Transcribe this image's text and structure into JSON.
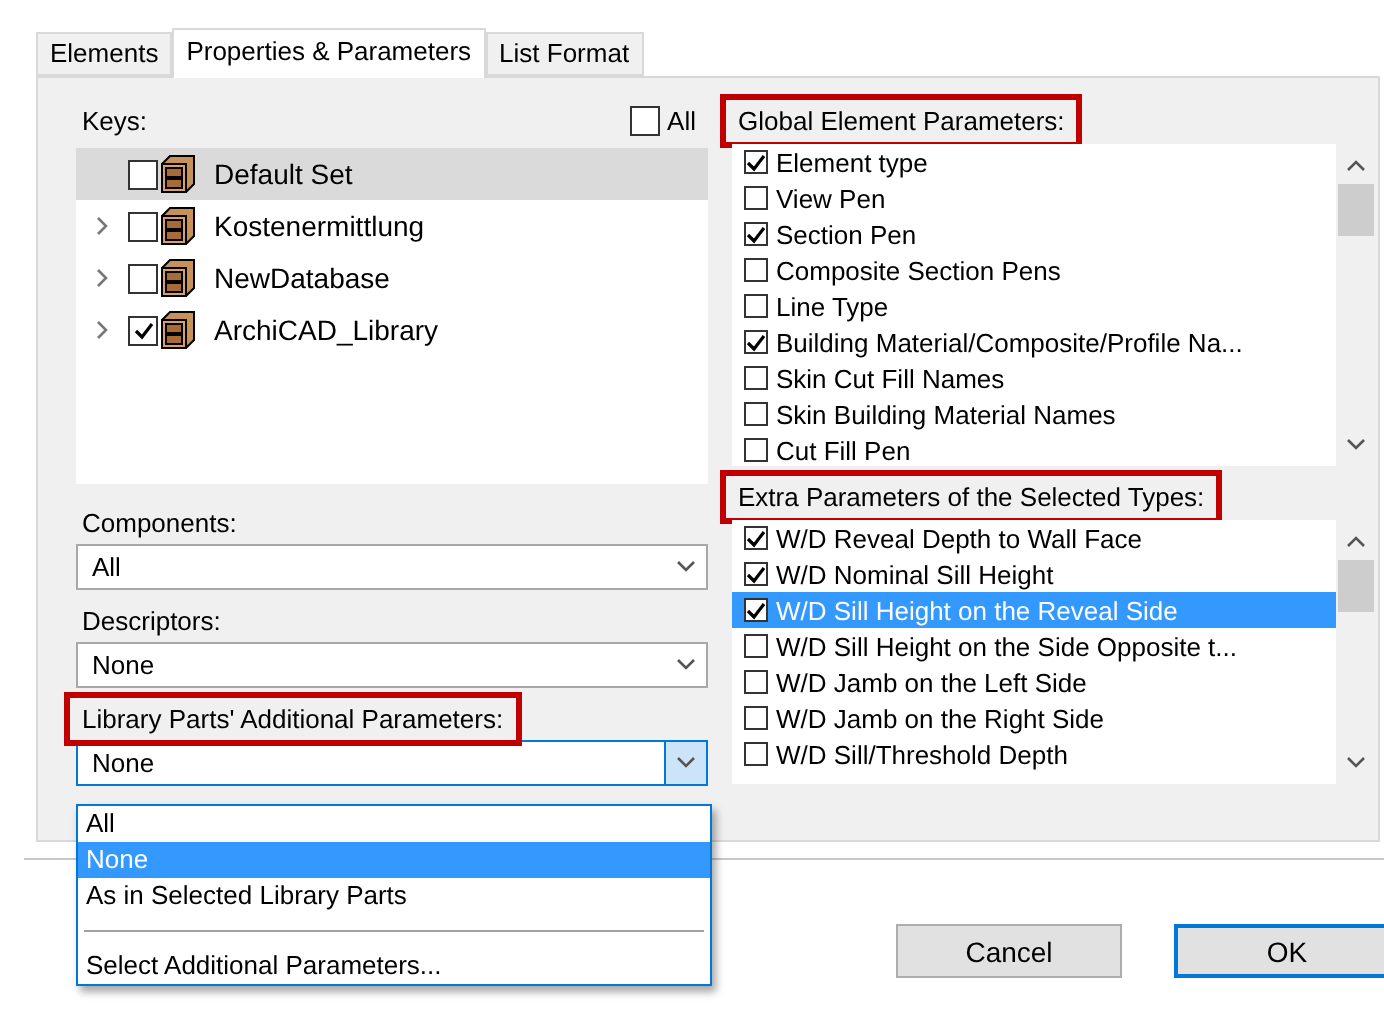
{
  "tabs": [
    {
      "label": "Elements",
      "selected": false
    },
    {
      "label": "Properties & Parameters",
      "selected": true
    },
    {
      "label": "List Format",
      "selected": false
    }
  ],
  "keys": {
    "label": "Keys:",
    "highlighted": false,
    "all_label": "All",
    "all_checked": false,
    "items": [
      {
        "label": "Default Set",
        "checked": false,
        "expandable": false,
        "selected": true
      },
      {
        "label": "Kostenermittlung",
        "checked": false,
        "expandable": true,
        "selected": false
      },
      {
        "label": "NewDatabase",
        "checked": false,
        "expandable": true,
        "selected": false
      },
      {
        "label": "ArchiCAD_Library",
        "checked": true,
        "expandable": true,
        "selected": false
      }
    ]
  },
  "selects": [
    {
      "label": "Components:",
      "highlighted": false,
      "value": "All",
      "expanded": false
    },
    {
      "label": "Descriptors:",
      "highlighted": false,
      "value": "None",
      "expanded": false
    },
    {
      "label": "Library Parts' Additional Parameters:",
      "highlighted": true,
      "value": "None",
      "expanded": true,
      "options": [
        {
          "kind": "option",
          "label": "All",
          "selected": false
        },
        {
          "kind": "option",
          "label": "None",
          "selected": true
        },
        {
          "kind": "option",
          "label": "As in Selected Library Parts",
          "selected": false
        },
        {
          "kind": "separator"
        },
        {
          "kind": "option",
          "label": "Select Additional Parameters...",
          "selected": false
        }
      ]
    }
  ],
  "global_parameters": {
    "label": "Global Element Parameters:",
    "highlighted": true,
    "items": [
      {
        "label": "Element type",
        "checked": true,
        "selected": false
      },
      {
        "label": "View Pen",
        "checked": false,
        "selected": false
      },
      {
        "label": "Section Pen",
        "checked": true,
        "selected": false
      },
      {
        "label": "Composite Section Pens",
        "checked": false,
        "selected": false
      },
      {
        "label": "Line Type",
        "checked": false,
        "selected": false
      },
      {
        "label": "Building Material/Composite/Profile Na...",
        "checked": true,
        "selected": false
      },
      {
        "label": "Skin Cut Fill Names",
        "checked": false,
        "selected": false
      },
      {
        "label": "Skin Building Material Names",
        "checked": false,
        "selected": false
      },
      {
        "label": "Cut Fill Pen",
        "checked": false,
        "selected": false
      }
    ]
  },
  "extra_parameters": {
    "label": "Extra Parameters of the Selected Types:",
    "highlighted": true,
    "items": [
      {
        "label": "W/D Reveal Depth to Wall Face",
        "checked": true,
        "selected": false
      },
      {
        "label": "W/D Nominal Sill Height",
        "checked": true,
        "selected": false
      },
      {
        "label": "W/D Sill Height on the Reveal Side",
        "checked": true,
        "selected": true
      },
      {
        "label": "W/D Sill Height on the Side Opposite t...",
        "checked": false,
        "selected": false
      },
      {
        "label": "W/D Jamb on the Left Side",
        "checked": false,
        "selected": false
      },
      {
        "label": "W/D Jamb on the Right Side",
        "checked": false,
        "selected": false
      },
      {
        "label": "W/D Sill/Threshold Depth",
        "checked": false,
        "selected": false
      }
    ]
  },
  "buttons": [
    {
      "label": "Cancel",
      "default": false
    },
    {
      "label": "OK",
      "default": true
    }
  ]
}
